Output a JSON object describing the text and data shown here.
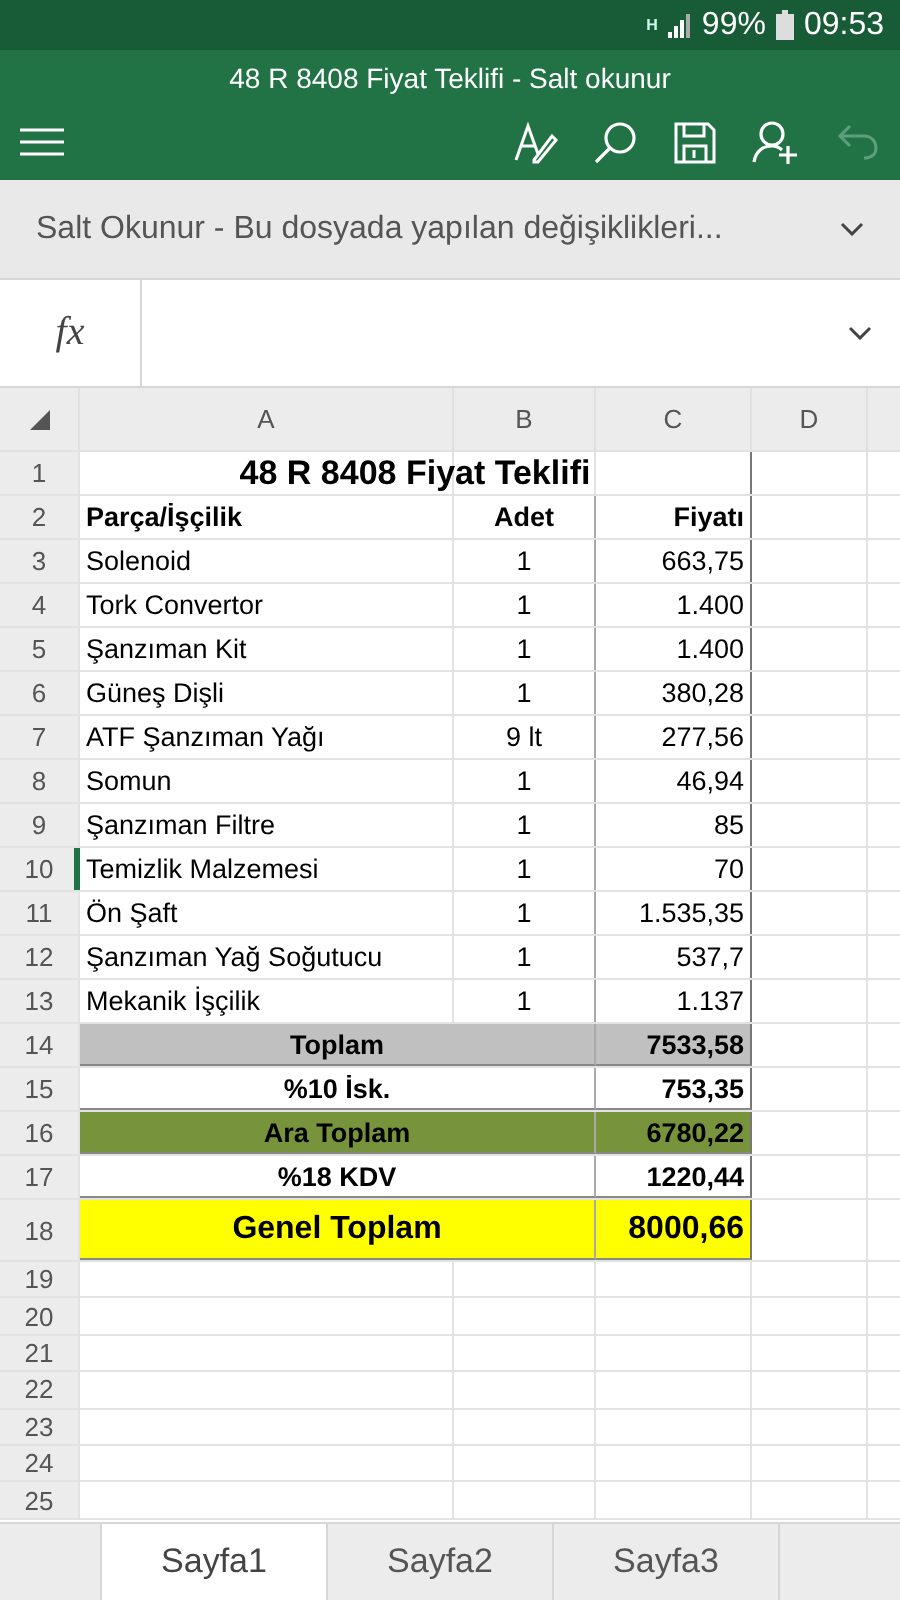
{
  "status_bar": {
    "network": "H",
    "battery": "99%",
    "time": "09:53"
  },
  "window": {
    "title": "48 R 8408 Fiyat Teklifi - Salt okunur"
  },
  "toolbar": {
    "undo_disabled": true
  },
  "info_bar": {
    "message": "Salt Okunur - Bu dosyada yapılan değişiklikleri..."
  },
  "formula_bar": {
    "label": "fx"
  },
  "sheet": {
    "columns": [
      "A",
      "B",
      "C",
      "D"
    ],
    "rows": [
      {
        "number": "1",
        "kind": "title",
        "selected": false,
        "cells": [
          "48 R 8408 Fiyat Teklifi"
        ]
      },
      {
        "number": "2",
        "kind": "header",
        "selected": false,
        "cells": [
          "Parça/İşçilik",
          "Adet",
          "Fiyatı"
        ]
      },
      {
        "number": "3",
        "kind": "item",
        "selected": false,
        "cells": [
          "Solenoid",
          "1",
          "663,75"
        ]
      },
      {
        "number": "4",
        "kind": "item",
        "selected": false,
        "cells": [
          "Tork Convertor",
          "1",
          "1.400"
        ]
      },
      {
        "number": "5",
        "kind": "item",
        "selected": false,
        "cells": [
          "Şanzıman Kit",
          "1",
          "1.400"
        ]
      },
      {
        "number": "6",
        "kind": "item",
        "selected": false,
        "cells": [
          "Güneş Dişli",
          "1",
          "380,28"
        ]
      },
      {
        "number": "7",
        "kind": "item",
        "selected": false,
        "cells": [
          "ATF Şanzıman Yağı",
          "9 lt",
          "277,56"
        ]
      },
      {
        "number": "8",
        "kind": "item",
        "selected": false,
        "cells": [
          "Somun",
          "1",
          "46,94"
        ]
      },
      {
        "number": "9",
        "kind": "item",
        "selected": false,
        "cells": [
          "Şanzıman Filtre",
          "1",
          "85"
        ]
      },
      {
        "number": "10",
        "kind": "item",
        "selected": true,
        "cells": [
          "Temizlik Malzemesi",
          "1",
          "70"
        ]
      },
      {
        "number": "11",
        "kind": "item",
        "selected": false,
        "cells": [
          "Ön Şaft",
          "1",
          "1.535,35"
        ]
      },
      {
        "number": "12",
        "kind": "item",
        "selected": false,
        "cells": [
          "Şanzıman Yağ Soğutucu",
          "1",
          "537,7"
        ]
      },
      {
        "number": "13",
        "kind": "item",
        "selected": false,
        "cells": [
          "Mekanik İşçilik",
          "1",
          "1.137"
        ]
      },
      {
        "number": "14",
        "kind": "summary",
        "selected": false,
        "color": "#c0c0c0",
        "cells": [
          "Toplam",
          "7533,58"
        ]
      },
      {
        "number": "15",
        "kind": "summary",
        "selected": false,
        "color": "#ffffff",
        "cells": [
          "%10 İsk.",
          "753,35"
        ]
      },
      {
        "number": "16",
        "kind": "summary",
        "selected": false,
        "color": "#77933c",
        "cells": [
          "Ara Toplam",
          "6780,22"
        ]
      },
      {
        "number": "17",
        "kind": "summary",
        "selected": false,
        "color": "#ffffff",
        "cells": [
          "%18 KDV",
          "1220,44"
        ]
      },
      {
        "number": "18",
        "kind": "grand",
        "selected": false,
        "color": "#ffff00",
        "cells": [
          "Genel Toplam",
          "8000,66"
        ]
      },
      {
        "number": "19",
        "kind": "empty",
        "selected": false
      },
      {
        "number": "20",
        "kind": "empty",
        "selected": false
      },
      {
        "number": "21",
        "kind": "empty",
        "selected": false
      },
      {
        "number": "22",
        "kind": "empty",
        "selected": false
      },
      {
        "number": "23",
        "kind": "empty",
        "selected": false
      },
      {
        "number": "24",
        "kind": "empty",
        "selected": false
      },
      {
        "number": "25",
        "kind": "empty",
        "selected": false
      }
    ]
  },
  "sheet_tabs": [
    {
      "label": "Sayfa1",
      "selected": true
    },
    {
      "label": "Sayfa2",
      "selected": false
    },
    {
      "label": "Sayfa3",
      "selected": false
    }
  ]
}
